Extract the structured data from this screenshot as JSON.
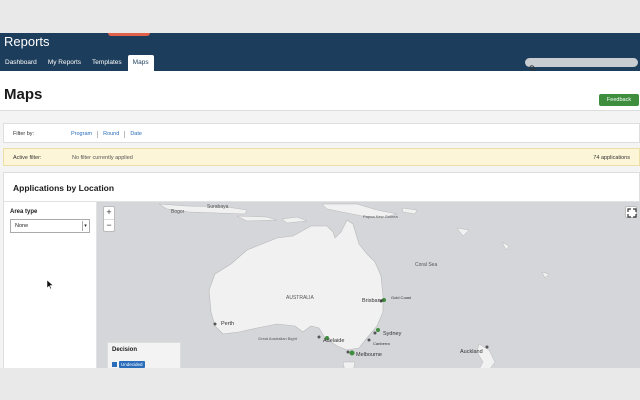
{
  "app": {
    "title": "Reports"
  },
  "nav": {
    "tabs": [
      {
        "label": "Dashboard"
      },
      {
        "label": "My Reports"
      },
      {
        "label": "Templates"
      },
      {
        "label": "Maps"
      }
    ],
    "active_index": 3
  },
  "page": {
    "title": "Maps",
    "feedback_label": "Feedback"
  },
  "filter": {
    "label": "Filter by:",
    "links": [
      "Program",
      "Round",
      "Date"
    ]
  },
  "active_filter": {
    "label": "Active filter:",
    "value": "No filter currently applied",
    "count": "74 applications"
  },
  "panel": {
    "title": "Applications by Location",
    "area_type_label": "Area type",
    "area_type_value": "None"
  },
  "map": {
    "zoom_in": "+",
    "zoom_out": "−",
    "region_labels": [
      {
        "text": "AUSTRALIA",
        "cls": "region"
      },
      {
        "text": "Great Australian Bight",
        "cls": "region"
      },
      {
        "text": "Bogor",
        "cls": "place"
      },
      {
        "text": "Surabaya",
        "cls": "place"
      },
      {
        "text": "Papua New Guinea",
        "cls": "place"
      },
      {
        "text": "Coral Sea",
        "cls": "place"
      }
    ],
    "cities": [
      {
        "text": "Perth"
      },
      {
        "text": "Adelaide"
      },
      {
        "text": "Melbourne"
      },
      {
        "text": "Sydney"
      },
      {
        "text": "Brisbane"
      },
      {
        "text": "Canberra"
      },
      {
        "text": "Gold Coast"
      },
      {
        "text": "Auckland"
      }
    ],
    "legend": {
      "title": "Decision",
      "items": [
        {
          "label": "Undecided",
          "color": "#2a6ebb",
          "checked": true
        }
      ]
    }
  },
  "colors": {
    "header": "#1c3d5b",
    "feedback": "#3e8e3e",
    "active_filter_bg": "#fcf5d8",
    "land": "#f1f1f1",
    "water": "#d4d6da"
  }
}
